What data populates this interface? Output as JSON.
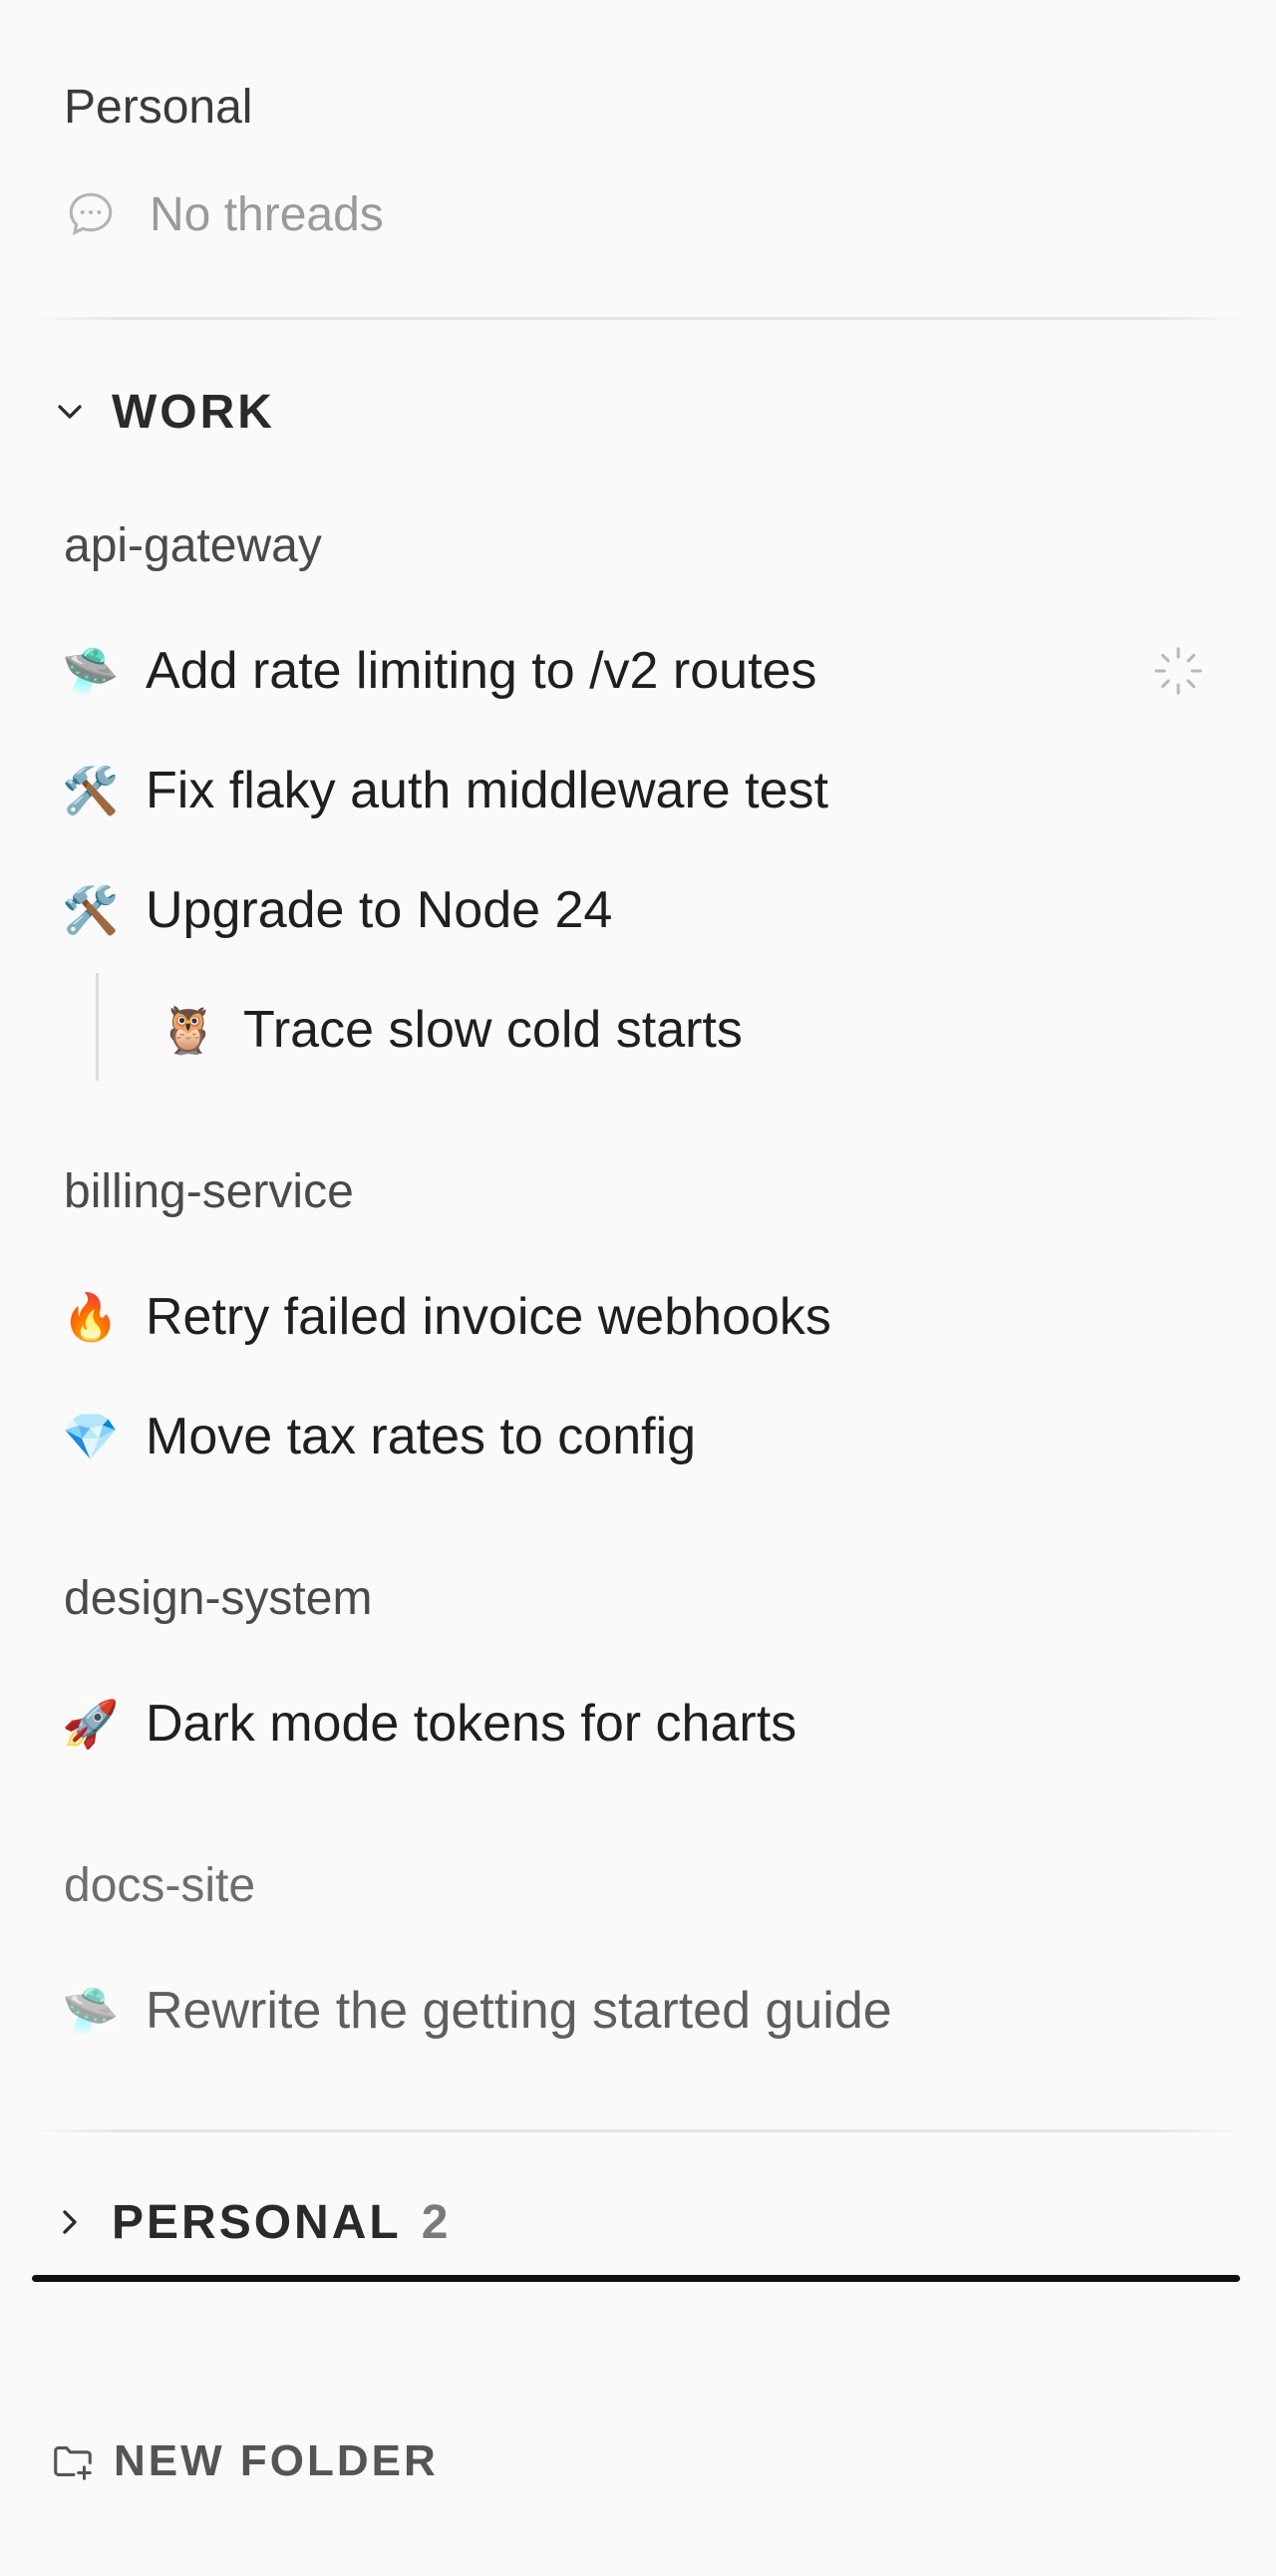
{
  "personal_top": {
    "label": "Personal",
    "empty_text": "No threads"
  },
  "work_section": {
    "title": "WORK",
    "groups": [
      {
        "name": "api-gateway",
        "threads": [
          {
            "emoji": "🛸",
            "title": "Add rate limiting to /v2 routes"
          },
          {
            "emoji": "🛠️",
            "title": "Fix flaky auth middleware test"
          },
          {
            "emoji": "🛠️",
            "title": "Upgrade to Node 24"
          },
          {
            "emoji": "🦉",
            "title": "Trace slow cold starts"
          }
        ]
      },
      {
        "name": "billing-service",
        "threads": [
          {
            "emoji": "🔥",
            "title": "Retry failed invoice webhooks"
          },
          {
            "emoji": "💎",
            "title": "Move tax rates to config"
          }
        ]
      },
      {
        "name": "design-system",
        "threads": [
          {
            "emoji": "🚀",
            "title": "Dark mode tokens for charts"
          }
        ]
      },
      {
        "name": "docs-site",
        "threads": [
          {
            "emoji": "🛸",
            "title": "Rewrite the getting started guide"
          }
        ]
      }
    ]
  },
  "personal_section": {
    "title": "PERSONAL",
    "count": "2"
  },
  "new_folder_label": "NEW FOLDER",
  "colors": {
    "background": "#fafafa",
    "text": "#1f1f1f",
    "muted": "#9a9a9a",
    "divider": "#e3e3e3",
    "drop_indicator": "#111111"
  },
  "icons": {
    "empty_state": "chat-bubble-icon",
    "running": "spinner-icon",
    "expand": "chevron-down-icon",
    "collapse": "chevron-right-icon",
    "new_folder": "folder-plus-icon"
  }
}
